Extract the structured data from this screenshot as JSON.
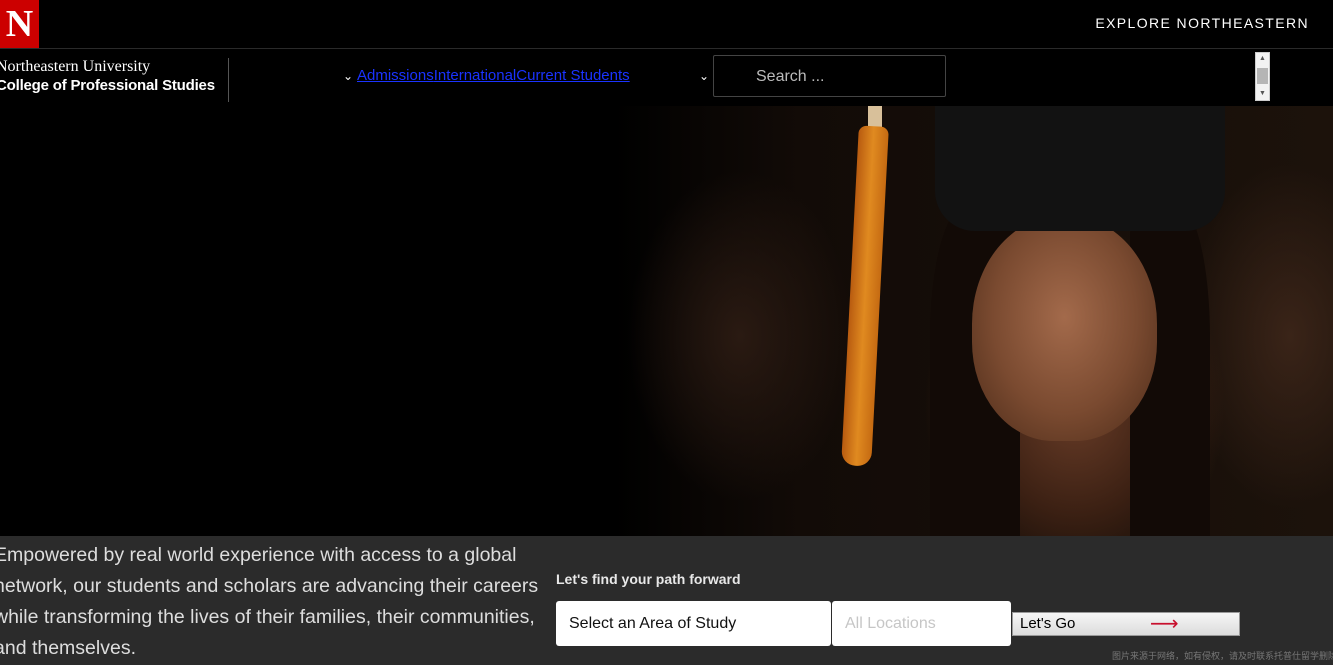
{
  "header": {
    "logo_letter": "N",
    "explore_label": "EXPLORE NORTHEASTERN"
  },
  "nav": {
    "brand_line1": "Northeastern University",
    "brand_line2": "College of Professional Studies",
    "links": [
      "Admissions",
      "International",
      "Current Students"
    ],
    "search_placeholder": "Search ..."
  },
  "hero": {
    "image_icon": "graduate-photo"
  },
  "finder": {
    "intro": "Empowered by real world experience with access to a global network, our students and scholars are advancing their careers while transforming the lives of their families, their communities, and themselves.",
    "label": "Let's find your path forward",
    "area_select": "Select an Area of Study",
    "location_select": "All Locations",
    "go_label": "Let's Go"
  },
  "watermark": "图片来源于网络，如有侵权，请及时联系托普仕留学删除",
  "colors": {
    "brand_red": "#cc0000",
    "link_blue": "#1a33ff",
    "arrow_red": "#c8102e"
  }
}
